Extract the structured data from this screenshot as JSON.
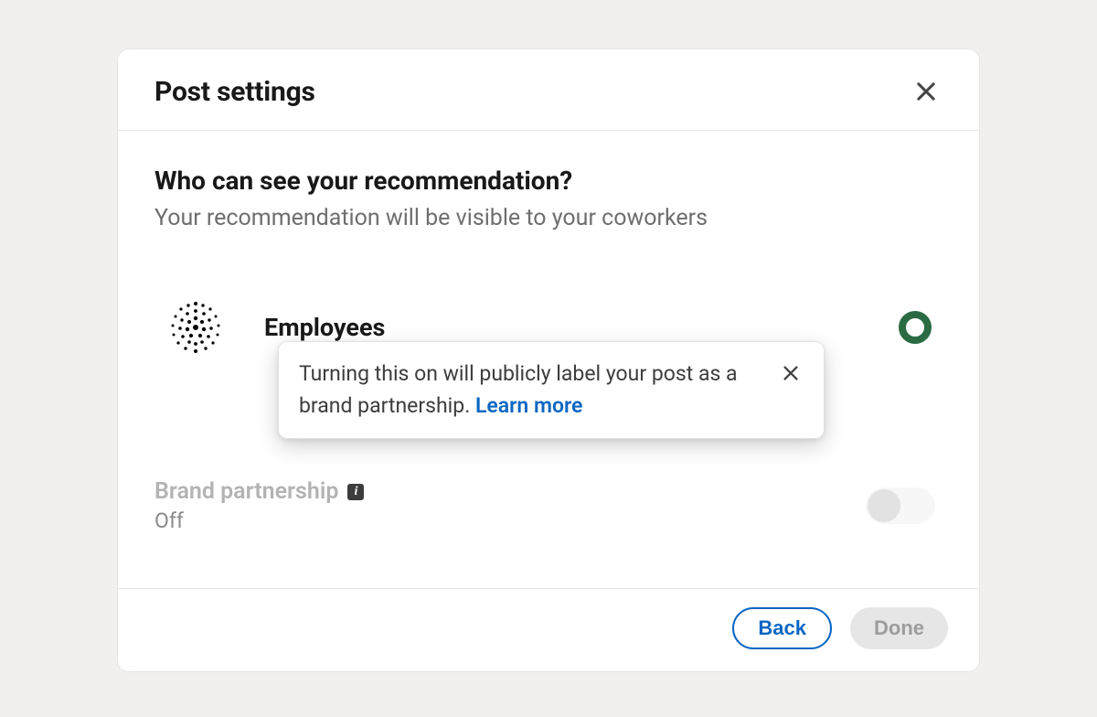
{
  "modal": {
    "title": "Post settings",
    "question": "Who can see your recommendation?",
    "subtext": "Your recommendation will be visible to your coworkers",
    "option": {
      "label": "Employees",
      "selected": true
    },
    "tooltip": {
      "text": "Turning this on will publicly label your post as a brand partnership. ",
      "learn_more_label": "Learn more"
    },
    "brand_partnership": {
      "label": "Brand partnership",
      "status": "Off"
    },
    "footer": {
      "back_label": "Back",
      "done_label": "Done"
    }
  }
}
